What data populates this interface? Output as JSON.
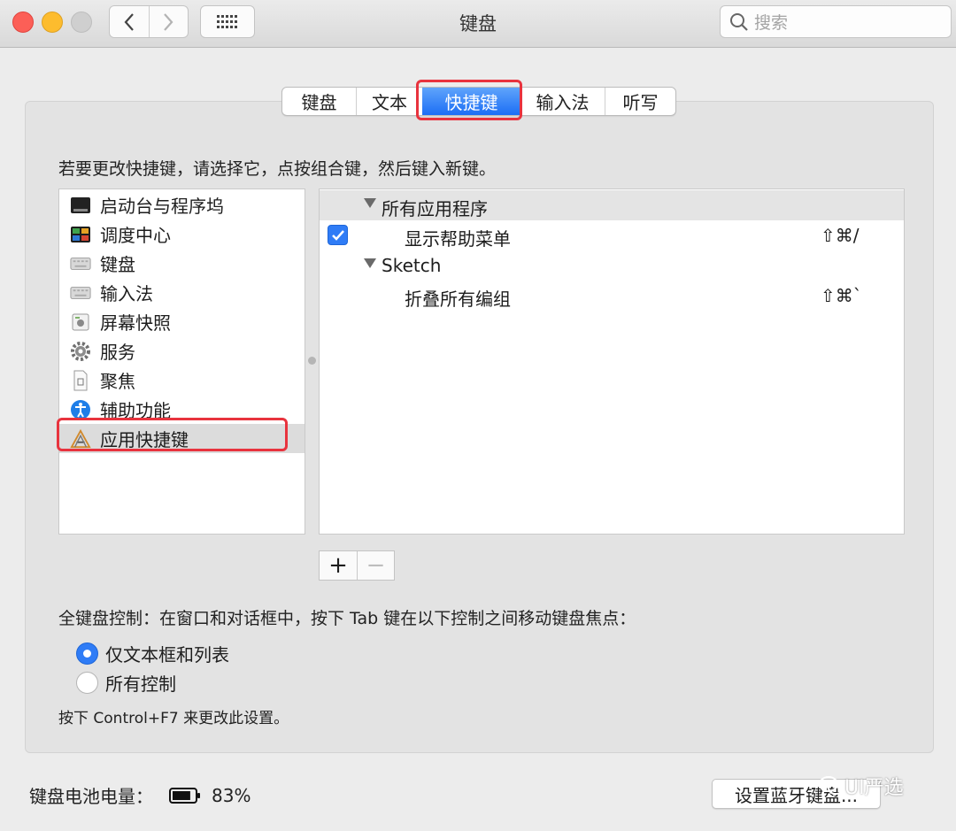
{
  "window": {
    "title": "键盘",
    "search_placeholder": "搜索"
  },
  "tabs": [
    {
      "label": "键盘",
      "selected": false
    },
    {
      "label": "文本",
      "selected": false
    },
    {
      "label": "快捷键",
      "selected": true
    },
    {
      "label": "输入法",
      "selected": false
    },
    {
      "label": "听写",
      "selected": false
    }
  ],
  "instruction": "若要更改快捷键，请选择它，点按组合键，然后键入新键。",
  "sidebar": {
    "items": [
      {
        "label": "启动台与程序坞",
        "icon": "launchpad-dock-icon"
      },
      {
        "label": "调度中心",
        "icon": "mission-control-icon"
      },
      {
        "label": "键盘",
        "icon": "keyboard-icon"
      },
      {
        "label": "输入法",
        "icon": "input-method-icon"
      },
      {
        "label": "屏幕快照",
        "icon": "screenshot-icon"
      },
      {
        "label": "服务",
        "icon": "gear-icon"
      },
      {
        "label": "聚焦",
        "icon": "spotlight-icon"
      },
      {
        "label": "辅助功能",
        "icon": "accessibility-icon"
      },
      {
        "label": "应用快捷键",
        "icon": "app-shortcuts-icon",
        "selected": true
      }
    ]
  },
  "shortcuts": {
    "group_all": "所有应用程序",
    "row_help_menu": {
      "label": "显示帮助菜单",
      "keys": "⇧⌘/",
      "checked": true
    },
    "group_sketch": "Sketch",
    "row_collapse": {
      "label": "折叠所有编组",
      "keys": "⇧⌘`"
    }
  },
  "buttons": {
    "add": "+",
    "remove": "−",
    "bluetooth": "设置蓝牙键盘..."
  },
  "full_keyboard": {
    "label": "全键盘控制：在窗口和对话框中，按下 Tab 键在以下控制之间移动键盘焦点：",
    "options": [
      {
        "label": "仅文本框和列表",
        "selected": true
      },
      {
        "label": "所有控制",
        "selected": false
      }
    ],
    "note": "按下 Control+F7 来更改此设置。"
  },
  "battery": {
    "label": "键盘电池电量：",
    "level_percent": 83,
    "text": "83%"
  },
  "watermark": "UI严选",
  "colors": {
    "accent": "#2f7cf6",
    "highlight_box": "#e8333e"
  }
}
